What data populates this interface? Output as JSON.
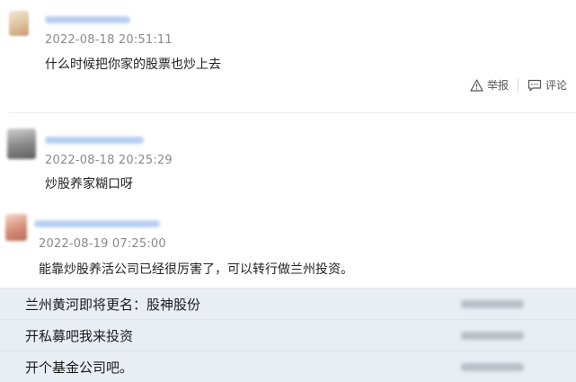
{
  "comments": [
    {
      "timestamp": "2022-08-18 20:51:11",
      "text": "什么时候把你家的股票也炒上去"
    },
    {
      "timestamp": "2022-08-18 20:25:29",
      "text": "炒股养家糊口呀"
    },
    {
      "timestamp": "2022-08-19 07:25:00",
      "text": "能靠炒股养活公司已经很厉害了，可以转行做兰州投资。"
    }
  ],
  "actions": {
    "report_label": "举报",
    "reply_label": "评论"
  },
  "replies": [
    {
      "text": "兰州黄河即将更名：股神股份"
    },
    {
      "text": "开私募吧我来投资"
    },
    {
      "text": "开个基金公司吧。"
    }
  ],
  "icons": {
    "report": "warning-triangle-icon",
    "reply": "speech-bubble-icon"
  },
  "colors": {
    "reply_bg": "#e9eef5",
    "username_blur": "#b8d0f2",
    "timestamp": "#8a8a8a"
  }
}
